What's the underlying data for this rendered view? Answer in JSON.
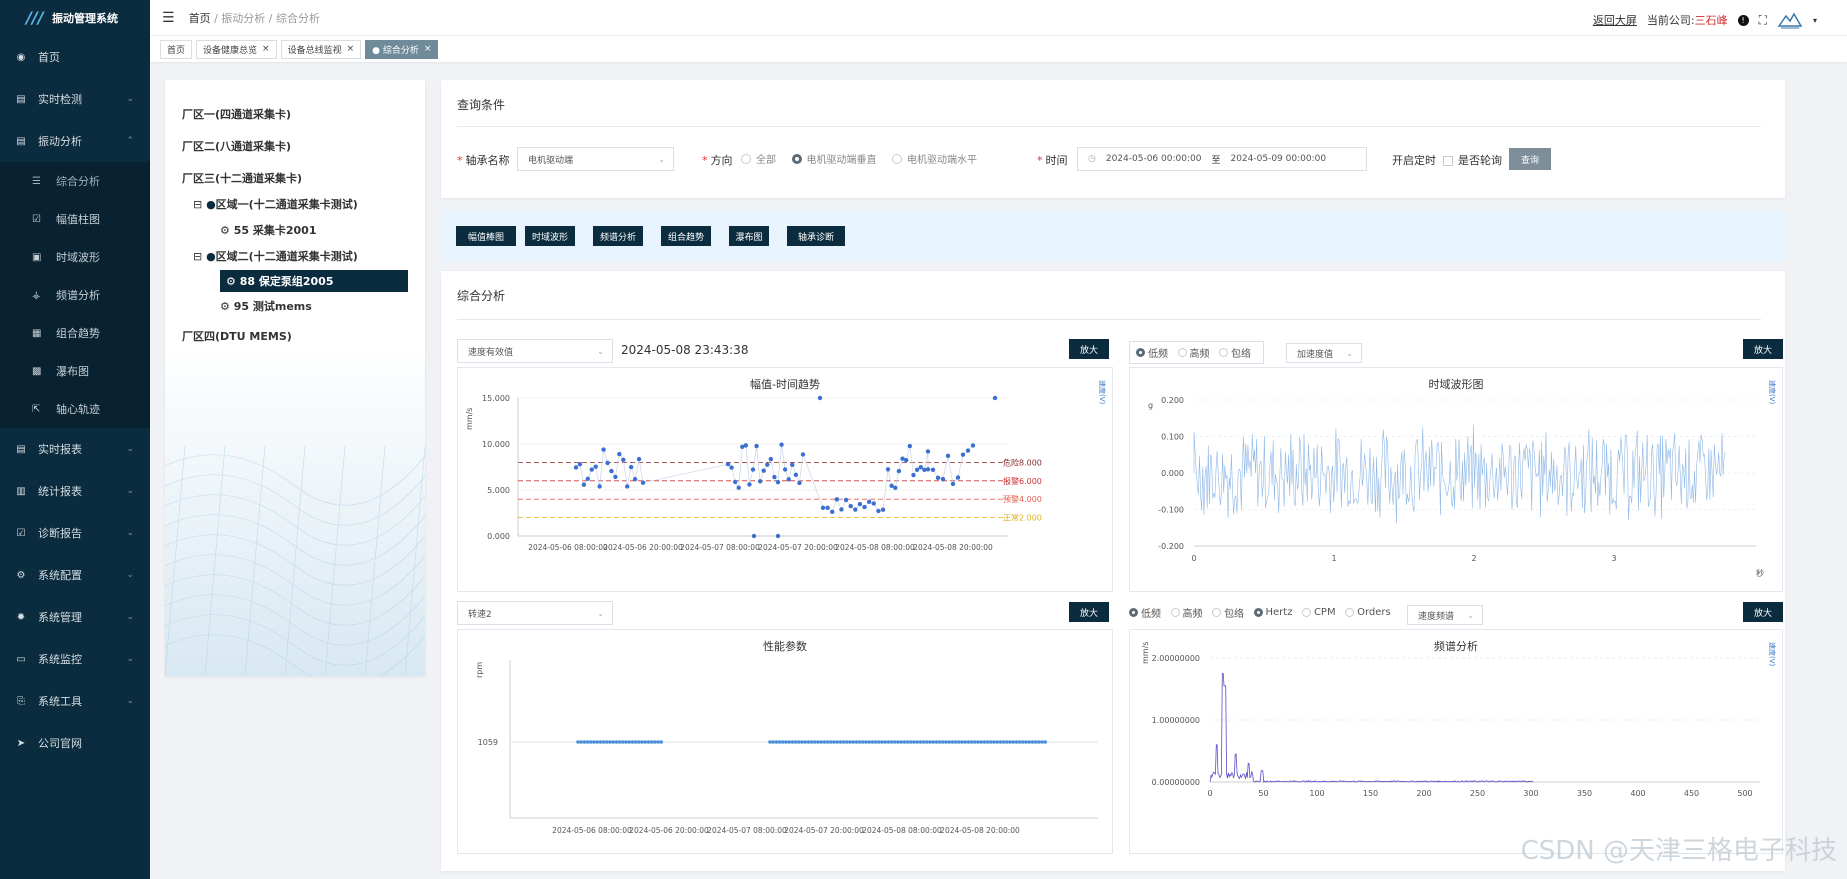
{
  "app": {
    "title": "振动管理系统"
  },
  "sidebar": {
    "items": [
      {
        "label": "首页",
        "icon": "dashboard-icon"
      },
      {
        "label": "实时检测",
        "icon": "monitor-icon"
      },
      {
        "label": "振动分析",
        "icon": "analysis-icon"
      },
      {
        "label": "实时报表",
        "icon": "report-icon"
      },
      {
        "label": "统计报表",
        "icon": "stats-icon"
      },
      {
        "label": "诊断报告",
        "icon": "diagnosis-icon"
      },
      {
        "label": "系统配置",
        "icon": "config-icon"
      },
      {
        "label": "系统管理",
        "icon": "gear-icon"
      },
      {
        "label": "系统监控",
        "icon": "monitor-icon"
      },
      {
        "label": "系统工具",
        "icon": "tool-icon"
      },
      {
        "label": "公司官网",
        "icon": "send-icon"
      }
    ],
    "sub": [
      {
        "label": "综合分析"
      },
      {
        "label": "幅值柱图"
      },
      {
        "label": "时域波形"
      },
      {
        "label": "频谱分析"
      },
      {
        "label": "组合趋势"
      },
      {
        "label": "瀑布图"
      },
      {
        "label": "轴心轨迹"
      }
    ]
  },
  "header": {
    "breadcrumb": [
      "首页",
      "振动分析",
      "综合分析"
    ],
    "big_screen": "返回大屏",
    "company_label": "当前公司:",
    "company": "三石峰"
  },
  "tabs": [
    {
      "label": "首页"
    },
    {
      "label": "设备健康总览"
    },
    {
      "label": "设备总线监视"
    },
    {
      "label": "● 综合分析"
    }
  ],
  "tree": {
    "areas": [
      "厂区一(四通道采集卡)",
      "厂区二(八通道采集卡)",
      "厂区三(十二通道采集卡)",
      "厂区四(DTU MEMS)"
    ],
    "zone1": "区域一(十二通道采集卡测试)",
    "zone1_child": "55 采集卡2001",
    "zone2": "区域二(十二通道采集卡测试)",
    "zone2_selected": "88 保定泵组2005",
    "zone2_child": "95 测试mems"
  },
  "query": {
    "title": "查询条件",
    "bearing_label": "轴承名称",
    "bearing_value": "电机驱动端",
    "direction_label": "方向",
    "dir_all": "全部",
    "dir_vertical": "电机驱动端垂直",
    "dir_horizontal": "电机驱动端水平",
    "time_label": "时间",
    "time_start": "2024-05-06 00:00:00",
    "time_to": "至",
    "time_end": "2024-05-09 00:00:00",
    "timer_label": "开启定时",
    "poll_label": "是否轮询",
    "search_btn": "查询"
  },
  "actions": [
    "幅值棒图",
    "时域波形",
    "频谱分析",
    "组合趋势",
    "瀑布图",
    "轴承诊断"
  ],
  "analysis": {
    "title": "综合分析",
    "zoom": "放大",
    "chart1": {
      "select": "速度有效值",
      "timestamp": "2024-05-08 23:43:38",
      "title": "幅值-时间趋势",
      "unit": "mm/s",
      "legend": "速度(V)",
      "ticks_y": [
        "15.000",
        "10.000",
        "5.000",
        "0.000"
      ],
      "ticks_x": [
        "2024-05-06 08:00:00",
        "2024-05-06 20:00:00",
        "2024-05-07 08:00:00",
        "2024-05-07 20:00:00",
        "2024-05-08 08:00:00",
        "2024-05-08 20:00:00"
      ],
      "thresholds": [
        {
          "label": "危险8.000",
          "value": 8,
          "color": "#8b2a2a"
        },
        {
          "label": "报警6.000",
          "value": 6,
          "color": "#d03030"
        },
        {
          "label": "预警4.000",
          "value": 4,
          "color": "#e06050"
        },
        {
          "label": "正常2.000",
          "value": 2,
          "color": "#e0b020"
        }
      ]
    },
    "chart2": {
      "radios": [
        "低频",
        "高频",
        "包络"
      ],
      "select": "加速度值",
      "title": "时域波形图",
      "unit": "g",
      "legend": "速度(V)",
      "ticks_y": [
        "0.200",
        "0.100",
        "0.000",
        "-0.100",
        "-0.200"
      ],
      "ticks_x": [
        "0",
        "1",
        "2",
        "3"
      ],
      "x_unit": "秒"
    },
    "chart3": {
      "select": "转速2",
      "title": "性能参数",
      "unit": "rpm",
      "value_label": "1059",
      "ticks_x": [
        "2024-05-06 08:00:00",
        "2024-05-06 20:00:00",
        "2024-05-07 08:00:00",
        "2024-05-07 20:00:00",
        "2024-05-08 08:00:00",
        "2024-05-08 20:00:00"
      ]
    },
    "chart4": {
      "radios": [
        "低频",
        "高频",
        "包络"
      ],
      "radios2": [
        "Hertz",
        "CPM",
        "Orders"
      ],
      "select": "速度频谱",
      "title": "频谱分析",
      "unit": "mm/s",
      "legend": "速度(V)",
      "ticks_y": [
        "2.00000000",
        "1.00000000",
        "0.00000000"
      ],
      "ticks_x": [
        "0",
        "50",
        "100",
        "150",
        "200",
        "250",
        "300",
        "350",
        "400",
        "450",
        "500"
      ]
    }
  },
  "watermark": "CSDN @天津三格电子科技"
}
